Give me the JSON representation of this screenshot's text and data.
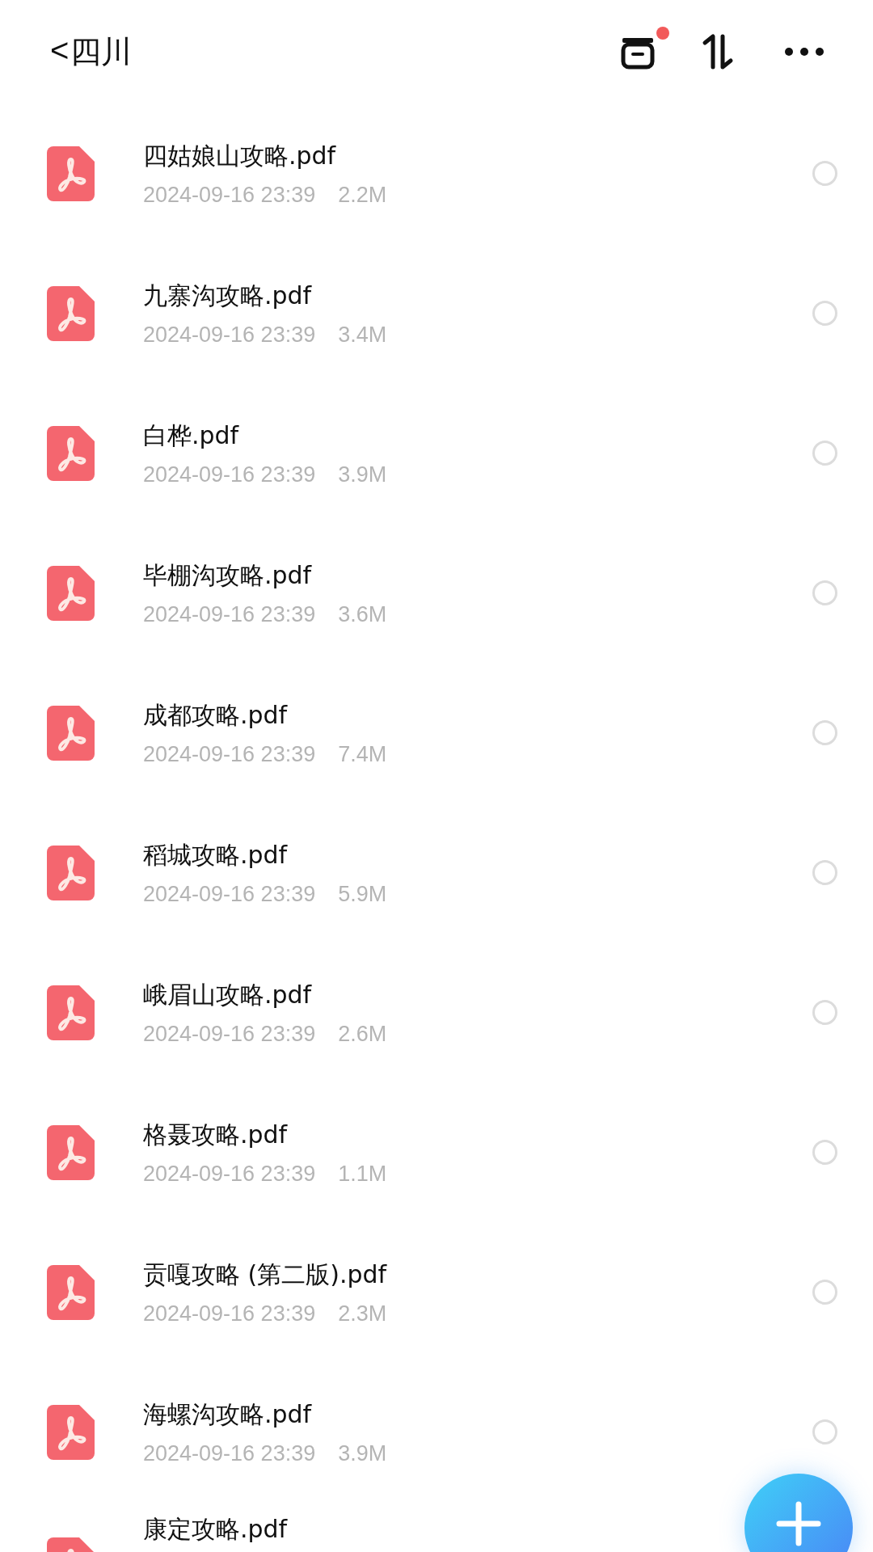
{
  "header": {
    "back": "<",
    "title": "四川",
    "notification_dot": true
  },
  "files": [
    {
      "name": "四姑娘山攻略.pdf",
      "date": "2024-09-16 23:39",
      "size": "2.2M",
      "selected": false
    },
    {
      "name": "九寨沟攻略.pdf",
      "date": "2024-09-16 23:39",
      "size": "3.4M",
      "selected": false
    },
    {
      "name": "白桦.pdf",
      "date": "2024-09-16 23:39",
      "size": "3.9M",
      "selected": false
    },
    {
      "name": "毕棚沟攻略.pdf",
      "date": "2024-09-16 23:39",
      "size": "3.6M",
      "selected": false
    },
    {
      "name": "成都攻略.pdf",
      "date": "2024-09-16 23:39",
      "size": "7.4M",
      "selected": false
    },
    {
      "name": "稻城攻略.pdf",
      "date": "2024-09-16 23:39",
      "size": "5.9M",
      "selected": false
    },
    {
      "name": "峨眉山攻略.pdf",
      "date": "2024-09-16 23:39",
      "size": "2.6M",
      "selected": false
    },
    {
      "name": "格聂攻略.pdf",
      "date": "2024-09-16 23:39",
      "size": "1.1M",
      "selected": false
    },
    {
      "name": "贡嘎攻略 (第二版).pdf",
      "date": "2024-09-16 23:39",
      "size": "2.3M",
      "selected": false
    },
    {
      "name": "海螺沟攻略.pdf",
      "date": "2024-09-16 23:39",
      "size": "3.9M",
      "selected": false
    },
    {
      "name": "康定攻略.pdf"
    }
  ]
}
